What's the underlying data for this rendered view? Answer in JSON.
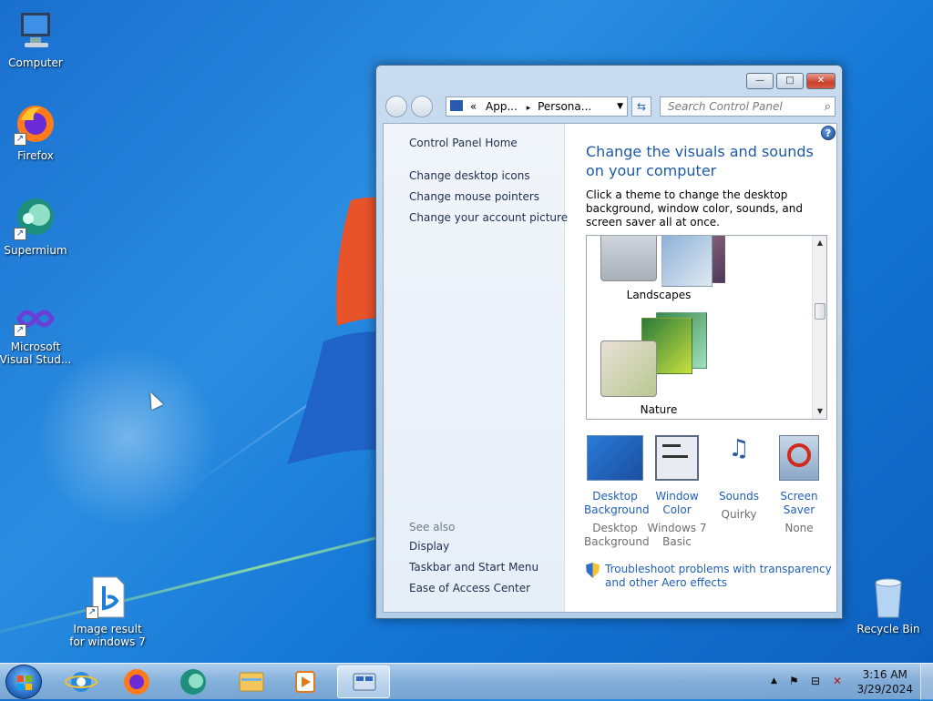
{
  "desktop": {
    "icons": [
      {
        "label": "Computer"
      },
      {
        "label": "Firefox"
      },
      {
        "label": "Supermium"
      },
      {
        "label": "Microsoft Visual Stud..."
      },
      {
        "label": "Image result for windows 7"
      },
      {
        "label": "Recycle Bin"
      }
    ]
  },
  "window": {
    "controls": {
      "minimize": "—",
      "maximize": "□",
      "close": "✕"
    },
    "address": {
      "chevron": "«",
      "crumb1": "App...",
      "sep": "▸",
      "crumb2": "Persona..."
    },
    "search_placeholder": "Search Control Panel",
    "help": "?",
    "left_links": [
      "Control Panel Home",
      "Change desktop icons",
      "Change mouse pointers",
      "Change your account picture"
    ],
    "see_also": {
      "title": "See also",
      "links": [
        "Display",
        "Taskbar and Start Menu",
        "Ease of Access Center"
      ]
    },
    "heading": "Change the visuals and sounds on your computer",
    "description": "Click a theme to change the desktop background, window color, sounds, and screen saver all at once.",
    "themes": [
      {
        "name": "Landscapes"
      },
      {
        "name": "Nature"
      }
    ],
    "tiles": [
      {
        "link": "Desktop Background",
        "value": "Desktop Background"
      },
      {
        "link": "Window Color",
        "value": "Windows 7 Basic"
      },
      {
        "link": "Sounds",
        "value": "Quirky"
      },
      {
        "link": "Screen Saver",
        "value": "None"
      }
    ],
    "troubleshoot": "Troubleshoot problems with transparency and other Aero effects"
  },
  "taskbar": {
    "items": [
      "internet-explorer",
      "firefox",
      "supermium",
      "explorer",
      "media-player",
      "control-panel"
    ],
    "clock": {
      "time": "3:16 AM",
      "date": "3/29/2024"
    },
    "tray_chevron": "▲"
  }
}
